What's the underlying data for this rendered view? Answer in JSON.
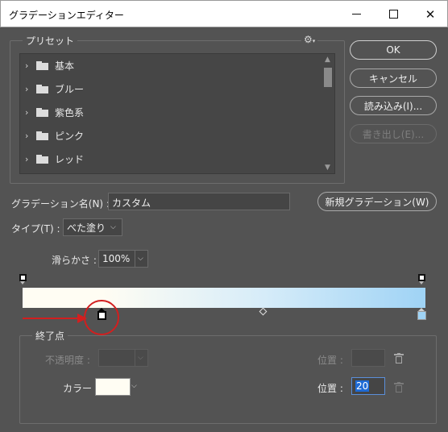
{
  "window": {
    "title": "グラデーションエディター",
    "min_glyph": "",
    "max_glyph": "",
    "close_glyph": "✕"
  },
  "presets": {
    "label": "プリセット",
    "gear_glyph": "⚙",
    "items": [
      {
        "label": "基本"
      },
      {
        "label": "ブルー"
      },
      {
        "label": "紫色系"
      },
      {
        "label": "ピンク"
      },
      {
        "label": "レッド"
      }
    ]
  },
  "buttons": {
    "ok": "OK",
    "cancel": "キャンセル",
    "load": "読み込み(I)...",
    "save": "書き出し(E)...",
    "new_gradient": "新規グラデーション(W)"
  },
  "gradient": {
    "name_label": "グラデーション名(N) :",
    "name_value": "カスタム",
    "type_label": "タイプ(T) :",
    "type_value": "べた塗り",
    "smoothness_label": "滑らかさ :",
    "smoothness_value": "100%",
    "color_stops": [
      {
        "location": 0,
        "color": "#fffdf3"
      },
      {
        "location": 20,
        "color": "#fffdf3",
        "selected": true
      },
      {
        "location": 100,
        "color": "#9fd3f5"
      }
    ],
    "midpoint_location": 60,
    "opacity_stops": [
      {
        "location": 0
      },
      {
        "location": 100
      }
    ]
  },
  "stops": {
    "label": "終了点",
    "opacity_label": "不透明度 :",
    "opacity_value": "",
    "opacity_location_label": "位置 :",
    "opacity_location_value": "",
    "color_label": "カラー :",
    "color_value": "#fffdf3",
    "color_location_label": "位置 :",
    "color_location_value": "20"
  },
  "colors": {
    "background": "#535353",
    "annotation": "#d21f1f",
    "selection": "#1e6bd6"
  }
}
